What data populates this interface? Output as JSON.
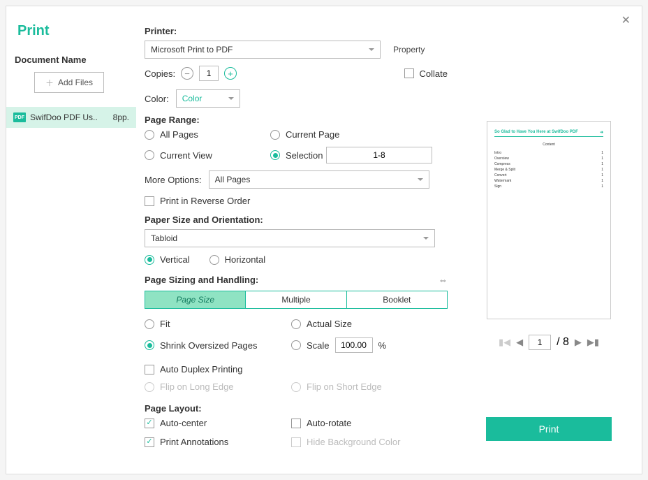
{
  "title": "Print",
  "sidebar": {
    "docs_label": "Document Name",
    "add_files": "Add Files",
    "file": {
      "name": "SwifDoo PDF Us..",
      "pages": "8pp."
    }
  },
  "printer": {
    "label": "Printer:",
    "value": "Microsoft Print to PDF",
    "property": "Property"
  },
  "copies": {
    "label": "Copies:",
    "value": "1",
    "collate": "Collate"
  },
  "color": {
    "label": "Color:",
    "value": "Color"
  },
  "range": {
    "label": "Page Range:",
    "all": "All Pages",
    "current_page": "Current Page",
    "current_view": "Current View",
    "selection": "Selection",
    "selection_value": "1-8"
  },
  "more": {
    "label": "More Options:",
    "value": "All Pages",
    "reverse": "Print in Reverse Order"
  },
  "paper": {
    "label": "Paper Size and Orientation:",
    "value": "Tabloid",
    "vertical": "Vertical",
    "horizontal": "Horizontal"
  },
  "sizing": {
    "label": "Page Sizing and Handling:",
    "tabs": {
      "page_size": "Page Size",
      "multiple": "Multiple",
      "booklet": "Booklet"
    },
    "fit": "Fit",
    "actual": "Actual Size",
    "shrink": "Shrink Oversized Pages",
    "scale": "Scale",
    "scale_value": "100.00",
    "scale_unit": "%"
  },
  "duplex": {
    "auto": "Auto Duplex Printing",
    "long": "Flip on Long Edge",
    "short": "Flip on Short Edge"
  },
  "layout": {
    "label": "Page Layout:",
    "auto_center": "Auto-center",
    "auto_rotate": "Auto-rotate",
    "annotations": "Print Annotations",
    "hide_bg": "Hide Background Color"
  },
  "preview": {
    "page": "1",
    "total": "/ 8",
    "doc": {
      "title": "So Glad to Have You Here at SwifDoo PDF",
      "content": "Content",
      "toc": [
        "Intro",
        "Overview",
        "Compress",
        "Merge & Split",
        "Convert",
        "Watermark",
        "Sign"
      ]
    }
  },
  "print_btn": "Print"
}
